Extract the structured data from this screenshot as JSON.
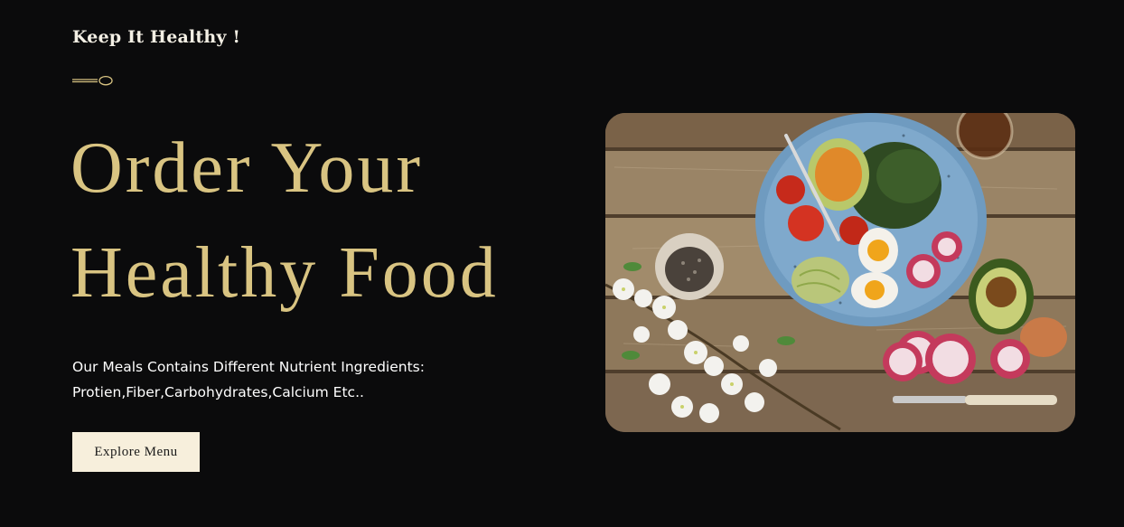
{
  "hero": {
    "tagline": "Keep It Healthy !",
    "headline_line1": "Order Your",
    "headline_line2": "Healthy Food",
    "description_line1": "Our Meals Contains Different Nutrient Ingredients:",
    "description_line2": "Protien,Fiber,Carbohydrates,Calcium Etc..",
    "cta_label": "Explore Menu"
  },
  "icons": {
    "divider": "spoon-icon"
  },
  "colors": {
    "background": "#0b0b0c",
    "accent_gold": "#d9c482",
    "button_bg": "#f7efdc",
    "text_light": "#ffffff"
  }
}
